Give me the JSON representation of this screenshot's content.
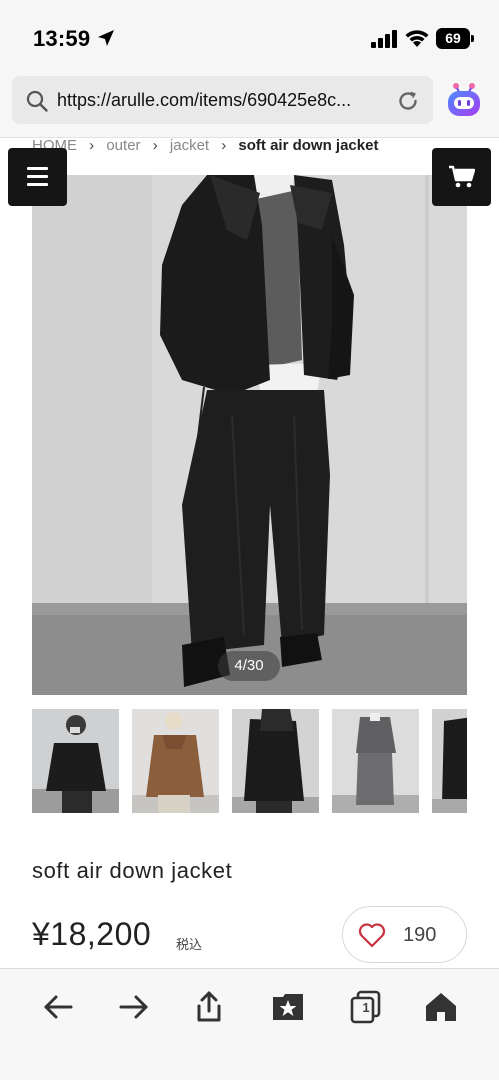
{
  "status_bar": {
    "time": "13:59",
    "battery_level": "69",
    "icons": [
      "location-arrow-icon",
      "signal-icon",
      "wifi-icon",
      "battery-icon"
    ]
  },
  "browser": {
    "url": "https://arulle.com/items/690425e8c...",
    "icons": [
      "search-icon",
      "reload-icon",
      "extension-icon"
    ]
  },
  "breadcrumb": {
    "items": [
      "HOME",
      "outer",
      "jacket"
    ],
    "current": "soft air down jacket"
  },
  "header": {
    "icons": [
      "menu-icon",
      "cart-icon"
    ]
  },
  "gallery": {
    "counter": "4/30",
    "current_index": 4,
    "total": 30,
    "thumbnail_count": 5
  },
  "product": {
    "name": "soft air down jacket",
    "price": "¥18,200",
    "tax_label": "税込",
    "like_count": "190"
  },
  "toolbar": {
    "tab_count": "1",
    "icons": [
      "back-arrow-icon",
      "forward-arrow-icon",
      "share-icon",
      "bookmarks-icon",
      "tabs-icon",
      "home-icon"
    ]
  },
  "colors": {
    "header_button_bg": "#151515",
    "heart": "#c8333f",
    "browser_chrome": "#f6f6f6",
    "extension_purple": "#7b52f5"
  }
}
